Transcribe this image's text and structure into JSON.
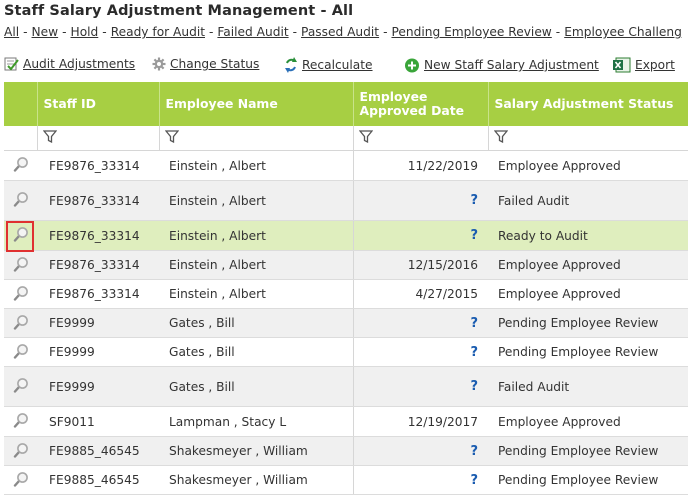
{
  "page": {
    "title": "Staff Salary Adjustment Management - All"
  },
  "filters": [
    {
      "label": "All"
    },
    {
      "label": "New"
    },
    {
      "label": "Hold"
    },
    {
      "label": "Ready for Audit"
    },
    {
      "label": "Failed Audit"
    },
    {
      "label": "Passed Audit"
    },
    {
      "label": "Pending Employee Review"
    },
    {
      "label": "Employee Challeng"
    }
  ],
  "filter_separator": "-",
  "toolbar": {
    "audit_adjustments": "Audit Adjustments",
    "change_status": "Change Status",
    "recalculate": "Recalculate",
    "new_adjustment": "New Staff Salary Adjustment",
    "export": "Export"
  },
  "grid": {
    "columns": {
      "staff_id": "Staff ID",
      "employee_name": "Employee Name",
      "approved_date_1": "Employee",
      "approved_date_2": "Approved Date",
      "status": "Salary Adjustment Status"
    },
    "missing_value": "?",
    "rows": [
      {
        "staff_id": "FE9876_33314",
        "name": "Einstein , Albert",
        "date": "11/22/2019",
        "status": "Employee Approved"
      },
      {
        "staff_id": "FE9876_33314",
        "name": "Einstein , Albert",
        "date": "",
        "status": "Failed Audit"
      },
      {
        "staff_id": "FE9876_33314",
        "name": "Einstein , Albert",
        "date": "",
        "status": "Ready to Audit"
      },
      {
        "staff_id": "FE9876_33314",
        "name": "Einstein , Albert",
        "date": "12/15/2016",
        "status": "Employee Approved"
      },
      {
        "staff_id": "FE9876_33314",
        "name": "Einstein , Albert",
        "date": "4/27/2015",
        "status": "Employee Approved"
      },
      {
        "staff_id": "FE9999",
        "name": "Gates , Bill",
        "date": "",
        "status": "Pending Employee Review"
      },
      {
        "staff_id": "FE9999",
        "name": "Gates , Bill",
        "date": "",
        "status": "Pending Employee Review"
      },
      {
        "staff_id": "FE9999",
        "name": "Gates , Bill",
        "date": "",
        "status": "Failed Audit"
      },
      {
        "staff_id": "SF9011",
        "name": "Lampman , Stacy L",
        "date": "12/19/2017",
        "status": "Employee Approved"
      },
      {
        "staff_id": "FE9885_46545",
        "name": "Shakesmeyer , William",
        "date": "",
        "status": "Pending Employee Review"
      },
      {
        "staff_id": "FE9885_46545",
        "name": "Shakesmeyer , William",
        "date": "",
        "status": "Pending Employee Review"
      }
    ]
  },
  "icons": {
    "row_view": "magnifier-icon",
    "column_filter": "funnel-icon",
    "audit": "audit-checklist-icon",
    "change_status": "gear-icon",
    "recalculate": "recalculate-arrows-icon",
    "new": "green-plus-icon",
    "export": "excel-icon"
  },
  "colors": {
    "header_green": "#a7cf43",
    "selected_row": "#dfeebe",
    "highlight_box": "#e03030",
    "question_mark": "#1a5cb0"
  }
}
